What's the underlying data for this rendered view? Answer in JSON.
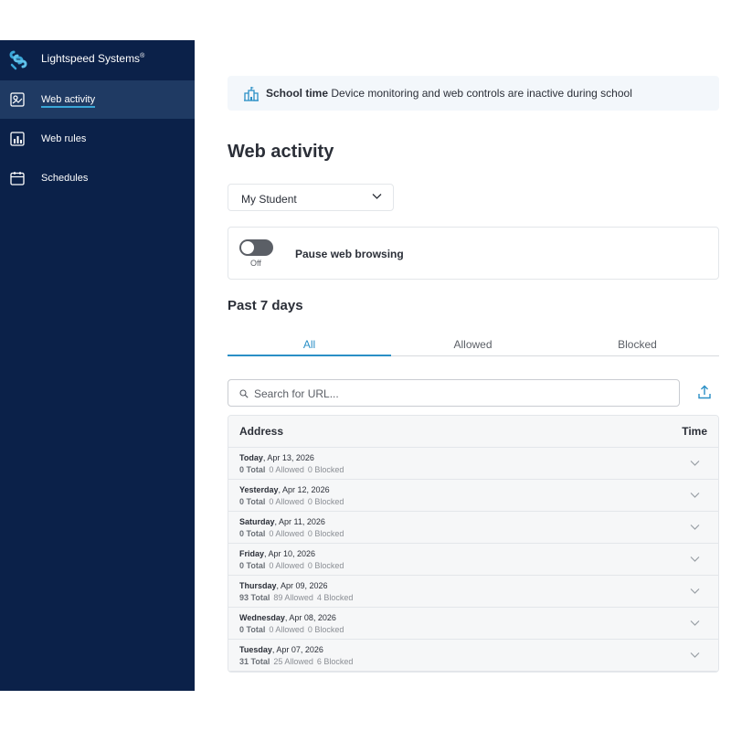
{
  "brand": {
    "name": "Lightspeed Systems",
    "mark": "®"
  },
  "sidebar": {
    "items": [
      {
        "label": "Web activity",
        "icon": "web-activity-icon",
        "active": true
      },
      {
        "label": "Web rules",
        "icon": "chart-icon",
        "active": false
      },
      {
        "label": "Schedules",
        "icon": "calendar-icon",
        "active": false
      }
    ]
  },
  "banner": {
    "title": "School time",
    "text": "Device monitoring and web controls are inactive during school",
    "icon": "school-icon"
  },
  "page": {
    "title": "Web activity"
  },
  "student_select": {
    "value": "My Student"
  },
  "pause": {
    "label": "Pause web browsing",
    "state": "Off",
    "enabled": false
  },
  "section": {
    "title": "Past 7 days"
  },
  "tabs": [
    {
      "label": "All",
      "active": true
    },
    {
      "label": "Allowed",
      "active": false
    },
    {
      "label": "Blocked",
      "active": false
    }
  ],
  "search": {
    "placeholder": "Search for URL...",
    "value": ""
  },
  "table": {
    "headers": {
      "address": "Address",
      "time": "Time"
    },
    "rows": [
      {
        "day": "Today",
        "date": ", Apr 13, 2026",
        "total": "0 Total",
        "allowed": "0 Allowed",
        "blocked": "0 Blocked"
      },
      {
        "day": "Yesterday",
        "date": ", Apr 12, 2026",
        "total": "0 Total",
        "allowed": "0 Allowed",
        "blocked": "0 Blocked"
      },
      {
        "day": "Saturday",
        "date": ", Apr 11, 2026",
        "total": "0 Total",
        "allowed": "0 Allowed",
        "blocked": "0 Blocked"
      },
      {
        "day": "Friday",
        "date": ", Apr 10, 2026",
        "total": "0 Total",
        "allowed": "0 Allowed",
        "blocked": "0 Blocked"
      },
      {
        "day": "Thursday",
        "date": ", Apr 09, 2026",
        "total": "93 Total",
        "allowed": "89 Allowed",
        "blocked": "4 Blocked"
      },
      {
        "day": "Wednesday",
        "date": ", Apr 08, 2026",
        "total": "0 Total",
        "allowed": "0 Allowed",
        "blocked": "0 Blocked"
      },
      {
        "day": "Tuesday",
        "date": ", Apr 07, 2026",
        "total": "31 Total",
        "allowed": "25 Allowed",
        "blocked": "6 Blocked"
      }
    ]
  },
  "colors": {
    "sidebar_bg": "#0b2149",
    "sidebar_active": "#1f3a63",
    "accent": "#2a8fc6",
    "banner_bg": "#f3f7fb"
  }
}
